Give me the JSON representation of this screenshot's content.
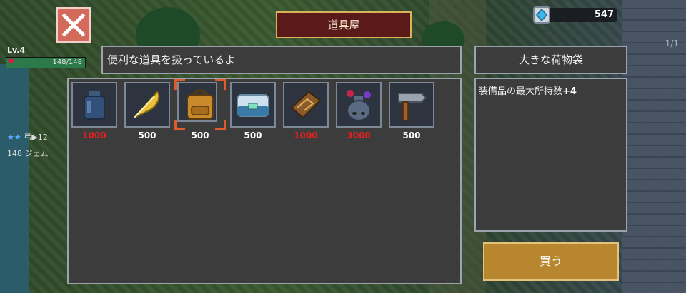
{
  "shop": {
    "title": "道具屋",
    "greeting": "便利な道具を扱っているよ",
    "selected_item_name": "大きな荷物袋",
    "description_text": "装備品の最大所持数",
    "description_value": "+4",
    "buy_label": "買う"
  },
  "hud": {
    "currency": "547",
    "page": "1/1",
    "level": "Lv.4",
    "hp": "148/148",
    "stars": "★★",
    "weapon": "弓▶12",
    "gems": "148 ジェム"
  },
  "items": [
    {
      "name": "blue-bottle",
      "price": "1000",
      "price_color": "red"
    },
    {
      "name": "golden-feather",
      "price": "500",
      "price_color": "white"
    },
    {
      "name": "big-bag",
      "price": "500",
      "price_color": "white",
      "selected": true
    },
    {
      "name": "storage-chest",
      "price": "500",
      "price_color": "white"
    },
    {
      "name": "leather-book",
      "price": "1000",
      "price_color": "red"
    },
    {
      "name": "potion-pot",
      "price": "3000",
      "price_color": "red"
    },
    {
      "name": "hammer",
      "price": "500",
      "price_color": "white"
    }
  ],
  "colors": {
    "price_red": "#e42020",
    "banner": "#5a1a1a",
    "buy_button": "#b8862f",
    "close_button": "#d36a5c",
    "selection": "#e05a2a"
  }
}
